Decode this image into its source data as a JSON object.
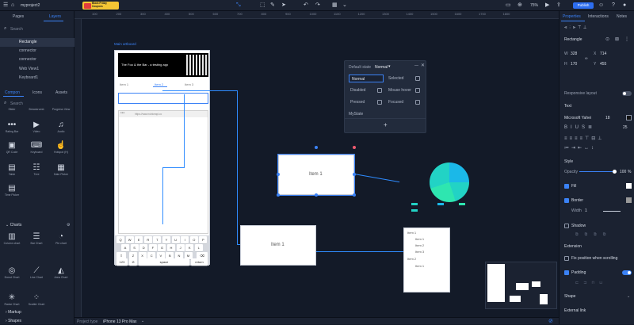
{
  "project": {
    "name": "myproject2"
  },
  "promo": {
    "line1": "Black Friday",
    "line2": "Coupons"
  },
  "toolbar": {
    "zoom": "75%",
    "publish": "Publish"
  },
  "left_tabs": {
    "pages": "Pages",
    "layers": "Layers"
  },
  "search_placeholder": "Search",
  "layers": [
    "Rectangle",
    "connector",
    "connector",
    "Web View1",
    "Keyboard1"
  ],
  "lib_tabs": {
    "component": "Compon",
    "icons": "Icons",
    "assets": "Assets"
  },
  "components": {
    "row0": [
      "Slider",
      "Breadcrumb",
      "Progress View"
    ],
    "row1": [
      "Rating Bar",
      "Video",
      "Audio"
    ],
    "row2": [
      "QR Code",
      "Keyboard",
      "Hotspot (H)"
    ],
    "row3": [
      "Table",
      "Tree",
      "Date Picker"
    ],
    "row4": [
      "Time Picker"
    ],
    "charts_title": "Charts",
    "charts1": [
      "Column chart",
      "Bar Chart",
      "Pie chart"
    ],
    "charts2": [
      "Donut Chart",
      "Line Chart",
      "Area Chart"
    ],
    "charts3": [
      "Radar Chart",
      "Scatter Chart"
    ]
  },
  "left_bottom": {
    "markup": "Markup",
    "shapes": "Shapes"
  },
  "ruler": [
    "100",
    "200",
    "300",
    "400",
    "500",
    "600",
    "700",
    "800",
    "900",
    "1000",
    "1100",
    "1200",
    "1300",
    "1400",
    "1500",
    "1600",
    "1700",
    "1800"
  ],
  "artboard": {
    "label": "Main artboard"
  },
  "phone": {
    "banner": "The Foo & the Bar - a testing app",
    "tabs": [
      "Item 1",
      "Item 2",
      "Item 3"
    ],
    "url": "https://www.rubiceapi.cc",
    "keys_row1": [
      "Q",
      "W",
      "E",
      "R",
      "T",
      "Y",
      "U",
      "I",
      "O",
      "P"
    ],
    "keys_row2": [
      "A",
      "S",
      "D",
      "F",
      "G",
      "H",
      "J",
      "K",
      "L"
    ],
    "keys_row3": [
      "Z",
      "X",
      "C",
      "V",
      "B",
      "N",
      "M"
    ],
    "key_123": "123",
    "key_space": "space",
    "key_return": "return"
  },
  "states": {
    "title": "Default state",
    "current": "Normal",
    "items": [
      "Normal",
      "Selected",
      "Disabled",
      "Mouse hover",
      "Pressed",
      "Focused"
    ],
    "mystate": "MyState",
    "add": "+"
  },
  "canvas_items": {
    "item1a": "Item 1",
    "item1b": "Item 1"
  },
  "tree": [
    "Item 1",
    "Item 1",
    "Item 2",
    "Item 3",
    "Item 2",
    "Item 1"
  ],
  "right_tabs": {
    "properties": "Properties",
    "interactions": "Interactions",
    "notes": "Notes"
  },
  "props": {
    "element": "Rectangle",
    "w": "328",
    "x": "714",
    "h": "170",
    "y": "455",
    "responsive": "Responsive layout",
    "text_section": "Text",
    "font": "Microsoft Yahei",
    "size": "18",
    "line_height": "25",
    "style_section": "Style",
    "opacity_label": "Opacity",
    "opacity": "100",
    "opacity_unit": "%",
    "fill": "Fill",
    "border": "Border",
    "width_label": "Width",
    "width_value": "1",
    "shadow": "Shadow",
    "extension": "Extension",
    "fix_position": "Fix position when scrolling",
    "padding": "Padding",
    "shape": "Shape",
    "external_link": "External link"
  },
  "bottom": {
    "project_type_label": "Project type",
    "project_type": "iPhone 13 Pro Max"
  },
  "colors": {
    "accent": "#3b82f6",
    "pie": "#22d3c5",
    "pie2": "#1bb8e8",
    "badge": "#f4c534"
  }
}
